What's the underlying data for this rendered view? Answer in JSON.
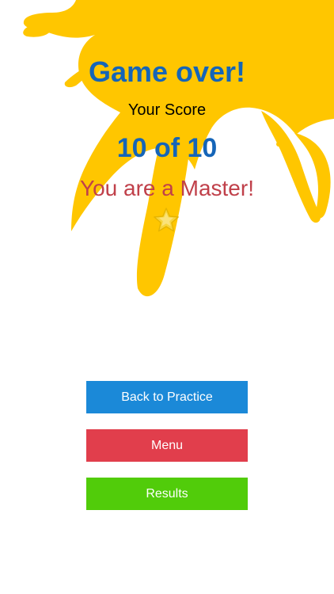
{
  "colors": {
    "splash": "#ffc600",
    "title": "#1565b8",
    "rank": "#c0404a",
    "practice_button": "#1b89d8",
    "menu_button": "#e13e4c",
    "results_button": "#51cc0a",
    "star": "#f7d43c"
  },
  "header": {
    "title": "Game over!"
  },
  "score": {
    "label": "Your Score",
    "value": "10 of 10"
  },
  "rank": {
    "text": "You are a Master!",
    "icon": "star-icon"
  },
  "decoration": {
    "icon": "paint-splash"
  },
  "buttons": {
    "practice": "Back to Practice",
    "menu": "Menu",
    "results": "Results"
  }
}
